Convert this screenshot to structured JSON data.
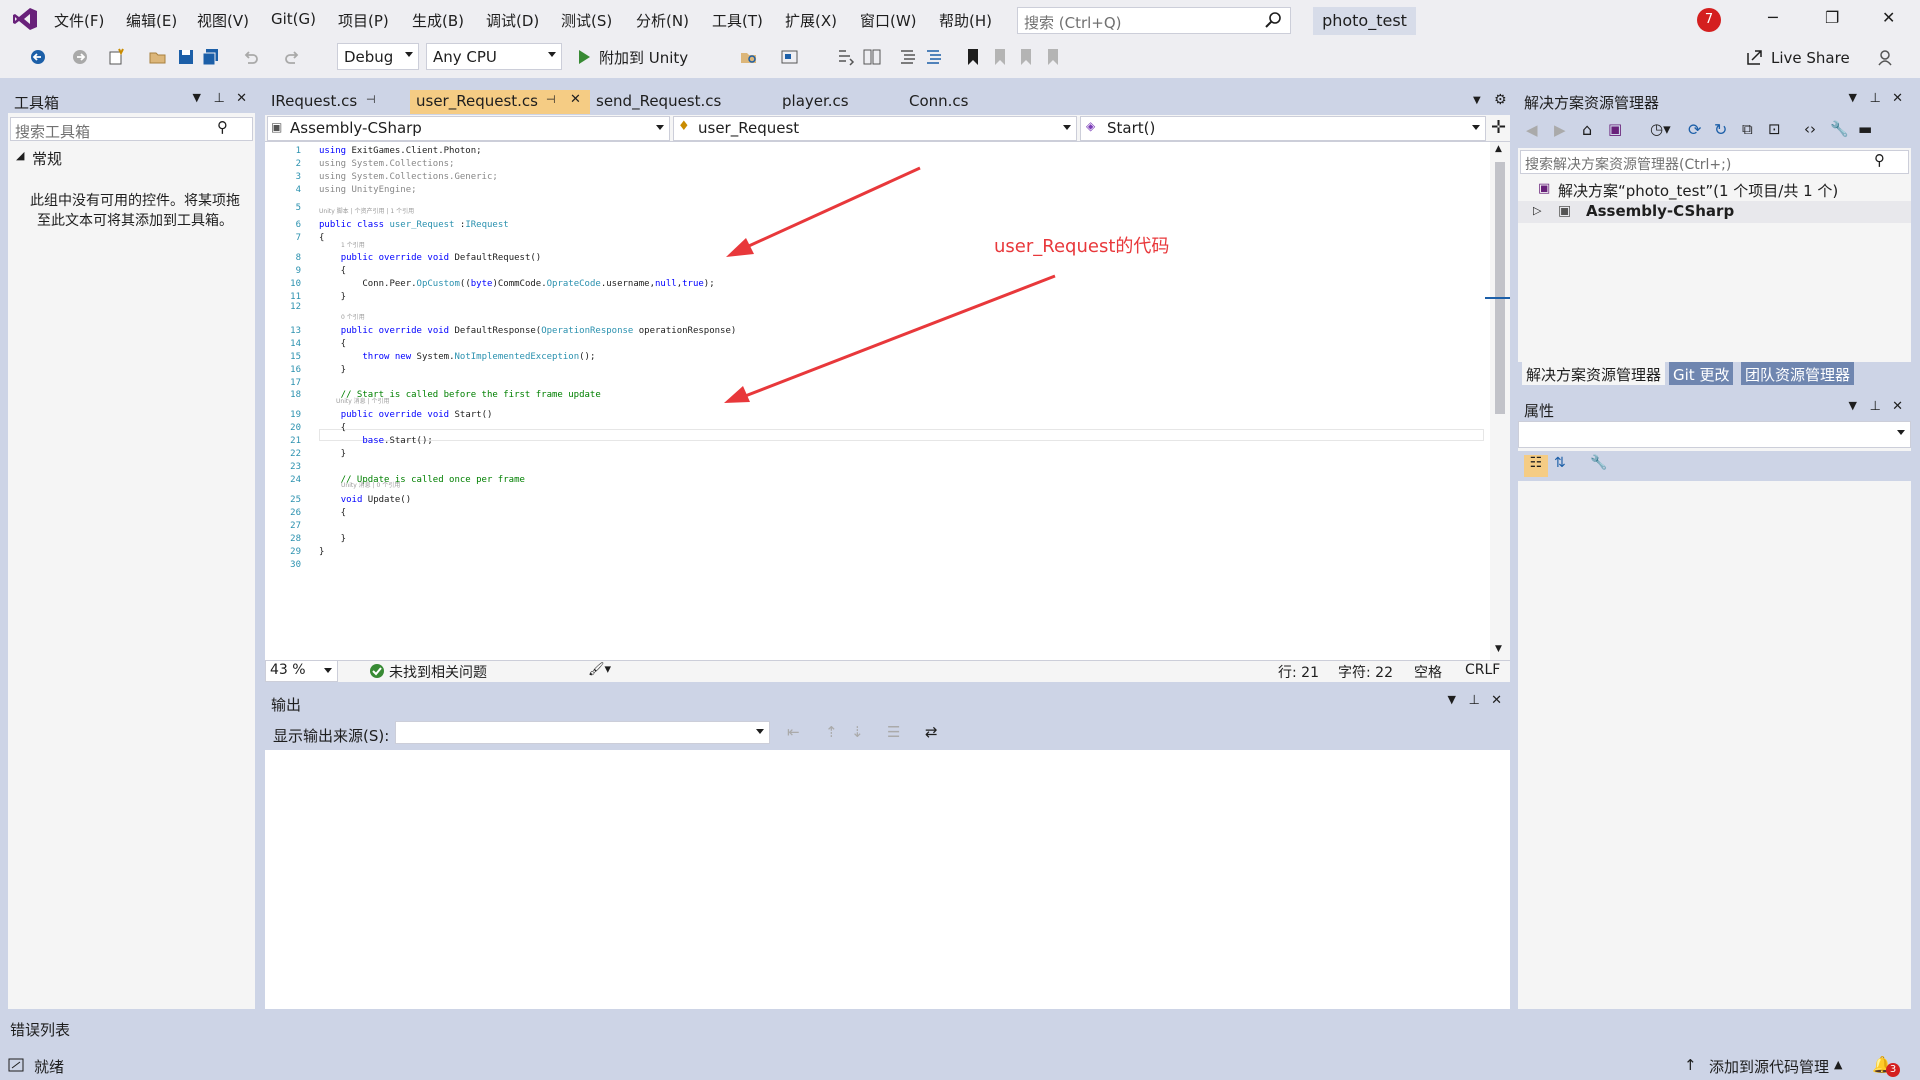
{
  "app": {
    "solution_name": "photo_test",
    "notifications": "7"
  },
  "menu": [
    "文件(F)",
    "编辑(E)",
    "视图(V)",
    "Git(G)",
    "项目(P)",
    "生成(B)",
    "调试(D)",
    "测试(S)",
    "分析(N)",
    "工具(T)",
    "扩展(X)",
    "窗口(W)",
    "帮助(H)"
  ],
  "search": {
    "placeholder": "搜索 (Ctrl+Q)"
  },
  "toolbar": {
    "config": "Debug",
    "platform": "Any CPU",
    "attach": "附加到 Unity",
    "live_share": "Live Share"
  },
  "toolbox": {
    "title": "工具箱",
    "search_placeholder": "搜索工具箱",
    "group": "常规",
    "empty_text": "此组中没有可用的控件。将某项拖至此文本可将其添加到工具箱。"
  },
  "editor": {
    "tabs": [
      "IRequest.cs",
      "user_Request.cs",
      "send_Request.cs",
      "player.cs",
      "Conn.cs"
    ],
    "nav_project": "Assembly-CSharp",
    "nav_class": "user_Request",
    "nav_member": "Start()",
    "zoom": "43 %",
    "status_ok": "未找到相关问题",
    "line": "行: 21",
    "col": "字符: 22",
    "spaces": "空格",
    "eol": "CRLF",
    "annotation": "user_Request的代码",
    "code": [
      {
        "n": "1",
        "t": "using ExitGames.Client.Photon;"
      },
      {
        "n": "2",
        "t": "using System.Collections;"
      },
      {
        "n": "3",
        "t": "using System.Collections.Generic;"
      },
      {
        "n": "4",
        "t": "using UnityEngine;"
      },
      {
        "n": "5",
        "t": ""
      },
      {
        "n": "6",
        "t": "public class user_Request :IRequest"
      },
      {
        "n": "7",
        "t": "{"
      },
      {
        "n": "8",
        "t": "    public override void DefaultRequest()"
      },
      {
        "n": "9",
        "t": "    {"
      },
      {
        "n": "10",
        "t": "        Conn.Peer.OpCustom((byte)CommCode.OprateCode.username,null,true);"
      },
      {
        "n": "11",
        "t": "    }"
      },
      {
        "n": "12",
        "t": ""
      },
      {
        "n": "13",
        "t": "    public override void DefaultResponse(OperationResponse operationResponse)"
      },
      {
        "n": "14",
        "t": "    {"
      },
      {
        "n": "15",
        "t": "        throw new System.NotImplementedException();"
      },
      {
        "n": "16",
        "t": "    }"
      },
      {
        "n": "17",
        "t": ""
      },
      {
        "n": "18",
        "t": "    // Start is called before the first frame update"
      },
      {
        "n": "19",
        "t": "    public override void Start()"
      },
      {
        "n": "20",
        "t": "    {"
      },
      {
        "n": "21",
        "t": "        base.Start();"
      },
      {
        "n": "22",
        "t": "    }"
      },
      {
        "n": "23",
        "t": ""
      },
      {
        "n": "24",
        "t": "    // Update is called once per frame"
      },
      {
        "n": "25",
        "t": "    void Update()"
      },
      {
        "n": "26",
        "t": "    {"
      },
      {
        "n": "27",
        "t": ""
      },
      {
        "n": "28",
        "t": "    }"
      },
      {
        "n": "29",
        "t": "}"
      },
      {
        "n": "30",
        "t": ""
      }
    ]
  },
  "output": {
    "title": "输出",
    "source_label": "显示输出来源(S):"
  },
  "solution_explorer": {
    "title": "解决方案资源管理器",
    "search_placeholder": "搜索解决方案资源管理器(Ctrl+;)",
    "solution_item": "解决方案“photo_test”(1 个项目/共 1 个)",
    "project_item": "Assembly-CSharp",
    "tabs": [
      "解决方案资源管理器",
      "Git 更改",
      "团队资源管理器"
    ]
  },
  "properties": {
    "title": "属性"
  },
  "error_list": {
    "title": "错误列表"
  },
  "statusbar": {
    "ready": "就绪",
    "add_source": "添加到源代码管理",
    "badge": "3"
  },
  "colors": {
    "accent": "#68217a",
    "frame": "#cdd4e6",
    "status_bar": "#cdd4e6",
    "annotation_red": "#e8383b"
  }
}
